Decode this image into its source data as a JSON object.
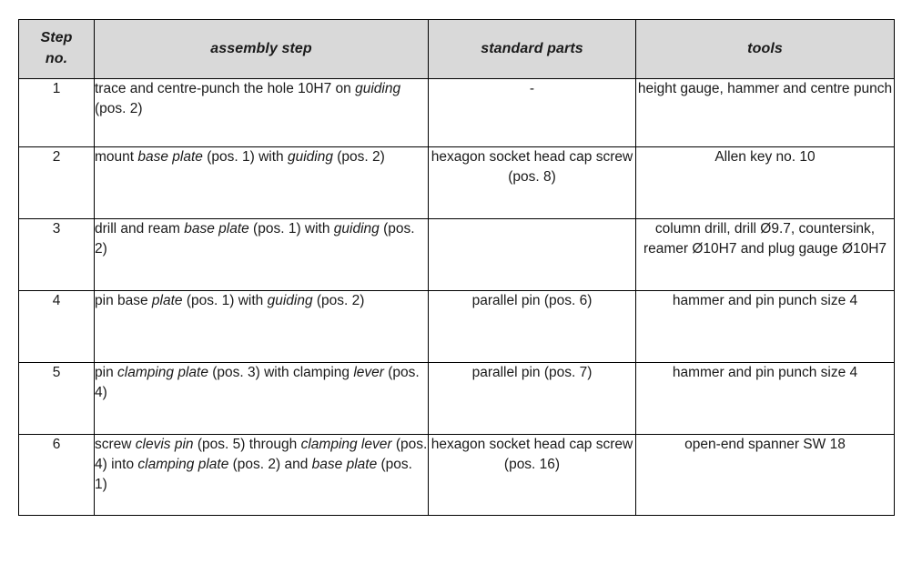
{
  "table": {
    "headers": {
      "step_no": "Step\nno.",
      "step_no_line1": "Step",
      "step_no_line2": "no.",
      "assembly_step": "assembly step",
      "standard_parts": "standard parts",
      "tools": "tools"
    },
    "header_background": "#d9d9d9",
    "border_color": "#000000",
    "rows": [
      {
        "step_no": "1",
        "assembly_step_parts": [
          {
            "text": "trace and centre-punch the hole 10H7 on ",
            "italic": false
          },
          {
            "text": "guiding",
            "italic": true
          },
          {
            "text": " (pos. 2)",
            "italic": false
          }
        ],
        "assembly_step_plain": "trace and centre-punch the hole 10H7 on guiding (pos. 2)",
        "standard_parts": "-",
        "tools": "height gauge, hammer and centre punch"
      },
      {
        "step_no": "2",
        "assembly_step_parts": [
          {
            "text": "mount ",
            "italic": false
          },
          {
            "text": "base plate",
            "italic": true
          },
          {
            "text": " (pos. 1) with ",
            "italic": false
          },
          {
            "text": "guiding",
            "italic": true
          },
          {
            "text": " (pos. 2)",
            "italic": false
          }
        ],
        "assembly_step_plain": "mount base plate (pos. 1) with guiding (pos. 2)",
        "standard_parts": "hexagon socket head cap screw (pos. 8)",
        "tools": "Allen key no. 10"
      },
      {
        "step_no": "3",
        "assembly_step_parts": [
          {
            "text": "drill and ream ",
            "italic": false
          },
          {
            "text": "base plate",
            "italic": true
          },
          {
            "text": " (pos. 1) with ",
            "italic": false
          },
          {
            "text": "guiding",
            "italic": true
          },
          {
            "text": " (pos. 2)",
            "italic": false
          }
        ],
        "assembly_step_plain": "drill and ream base plate (pos. 1) with guiding (pos. 2)",
        "standard_parts": "",
        "tools": "column drill, drill Ø9.7, countersink, reamer Ø10H7 and plug gauge Ø10H7"
      },
      {
        "step_no": "4",
        "assembly_step_parts": [
          {
            "text": "pin base ",
            "italic": false
          },
          {
            "text": "plate",
            "italic": true
          },
          {
            "text": " (pos. 1) with ",
            "italic": false
          },
          {
            "text": "guiding",
            "italic": true
          },
          {
            "text": " (pos. 2)",
            "italic": false
          }
        ],
        "assembly_step_plain": "pin base plate (pos. 1) with guiding (pos. 2)",
        "standard_parts": "parallel pin (pos. 6)",
        "tools": "hammer and pin punch size 4"
      },
      {
        "step_no": "5",
        "assembly_step_parts": [
          {
            "text": "pin ",
            "italic": false
          },
          {
            "text": "clamping plate",
            "italic": true
          },
          {
            "text": " (pos. 3) with clamping ",
            "italic": false
          },
          {
            "text": "lever",
            "italic": true
          },
          {
            "text": " (pos. 4)",
            "italic": false
          }
        ],
        "assembly_step_plain": "pin clamping plate (pos. 3) with clamping lever (pos. 4)",
        "standard_parts": "parallel pin (pos. 7)",
        "tools": "hammer and pin punch size 4"
      },
      {
        "step_no": "6",
        "assembly_step_parts": [
          {
            "text": "screw ",
            "italic": false
          },
          {
            "text": "clevis pin",
            "italic": true
          },
          {
            "text": " (pos. 5) through ",
            "italic": false
          },
          {
            "text": "clamping lever",
            "italic": true
          },
          {
            "text": " (pos. 4) into ",
            "italic": false
          },
          {
            "text": "clamping plate",
            "italic": true
          },
          {
            "text": " (pos. 2) and ",
            "italic": false
          },
          {
            "text": "base plate",
            "italic": true
          },
          {
            "text": " (pos. 1)",
            "italic": false
          }
        ],
        "assembly_step_plain": "screw clevis pin (pos. 5) through clamping lever (pos. 4) into clamping plate (pos. 2) and base plate (pos. 1)",
        "standard_parts": "hexagon socket head cap screw (pos. 16)",
        "tools": "open-end spanner SW 18"
      }
    ]
  }
}
